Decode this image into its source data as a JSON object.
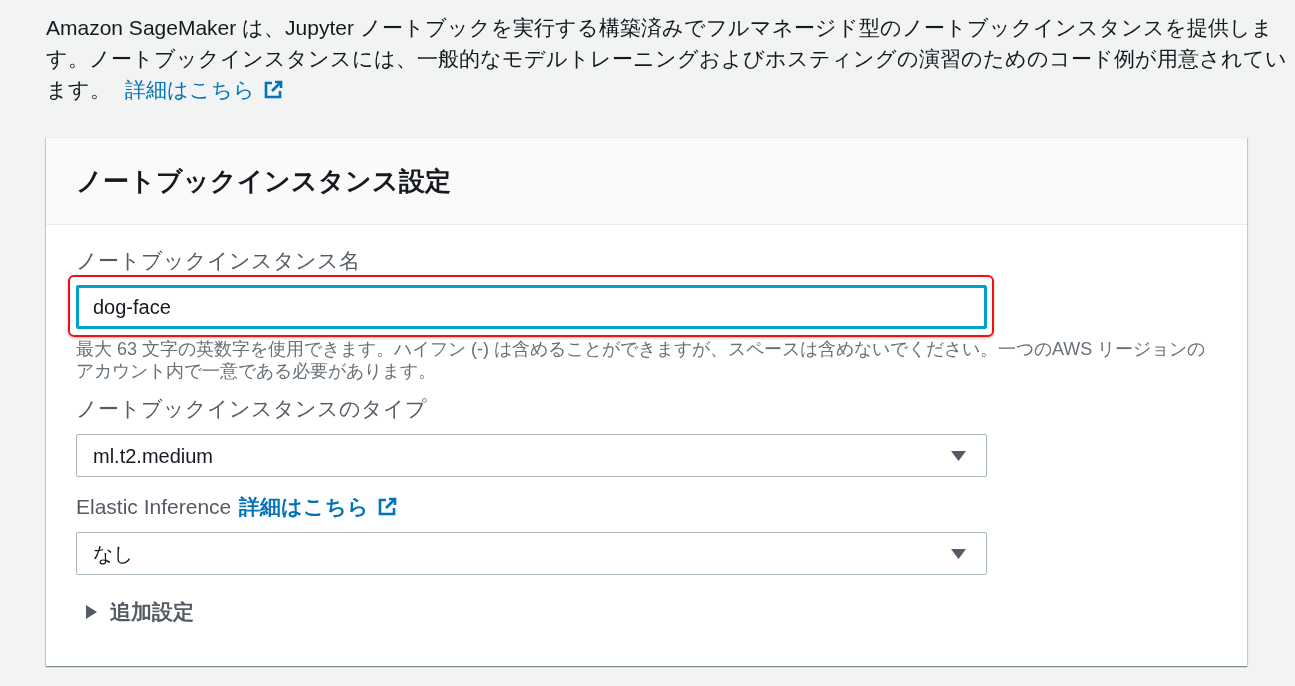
{
  "intro": {
    "text": "Amazon SageMaker は、Jupyter ノートブックを実行する構築済みでフルマネージド型のノートブックインスタンスを提供します。ノートブックインスタンスには、一般的なモデルトレーニングおよびホスティングの演習のためのコード例が用意されています。",
    "link": "詳細はこちら"
  },
  "panel": {
    "title": "ノートブックインスタンス設定",
    "fields": [
      {
        "kind": "text",
        "label": "ノートブックインスタンス名",
        "value": "dog-face",
        "focused": true,
        "highlighted": true,
        "hint": "最大 63 文字の英数字を使用できます。ハイフン (-) は含めることができますが、スペースは含めないでください。一つのAWS リージョンのアカウント内で一意である必要があります。"
      },
      {
        "kind": "select",
        "label": "ノートブックインスタンスのタイプ",
        "value": "ml.t2.medium"
      },
      {
        "kind": "select",
        "label": "Elastic Inference",
        "link": "詳細はこちら",
        "value": "なし"
      }
    ],
    "expander": {
      "label": "追加設定",
      "expanded": false
    }
  }
}
